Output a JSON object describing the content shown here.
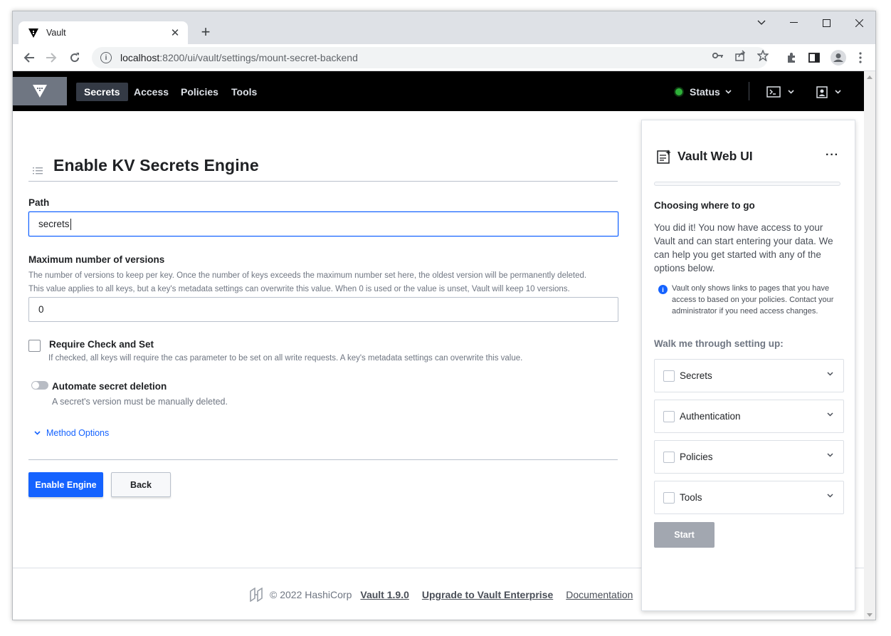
{
  "browser": {
    "tab_title": "Vault",
    "url_host": "localhost",
    "url_path": ":8200/ui/vault/settings/mount-secret-backend"
  },
  "vault_nav": {
    "links": [
      "Secrets",
      "Access",
      "Policies",
      "Tools"
    ],
    "active": "Secrets",
    "status_label": "Status",
    "status_color": "#2eb039"
  },
  "page": {
    "title": "Enable KV Secrets Engine",
    "path_label": "Path",
    "path_value": "secrets",
    "max_versions_label": "Maximum number of versions",
    "max_versions_help_1": "The number of versions to keep per key. Once the number of keys exceeds the maximum number set here, the oldest version will be permanently deleted.",
    "max_versions_help_2": "This value applies to all keys, but a key's metadata settings can overwrite this value. When 0 is used or the value is unset, Vault will keep 10 versions.",
    "max_versions_value": "0",
    "cas_label": "Require Check and Set",
    "cas_help": "If checked, all keys will require the cas parameter to be set on all write requests. A key's metadata settings can overwrite this value.",
    "auto_delete_label": "Automate secret deletion",
    "auto_delete_help": "A secret's version must be manually deleted.",
    "method_options": "Method Options",
    "enable_button": "Enable Engine",
    "back_button": "Back"
  },
  "footer": {
    "copyright": "© 2022 HashiCorp",
    "version_link": "Vault 1.9.0",
    "upgrade_link": "Upgrade to Vault Enterprise",
    "docs_link": "Documentation"
  },
  "wizard": {
    "title": "Vault Web UI",
    "heading": "Choosing where to go",
    "body": "You did it! You now have access to your Vault and can start entering your data. We can help you get started with any of the options below.",
    "info": "Vault only shows links to pages that you have access to based on your policies. Contact your administrator if you need access changes.",
    "walk_label": "Walk me through setting up:",
    "items": [
      "Secrets",
      "Authentication",
      "Policies",
      "Tools"
    ],
    "start_button": "Start"
  },
  "colors": {
    "accent": "#1563ff",
    "nav_bg": "#000000"
  }
}
